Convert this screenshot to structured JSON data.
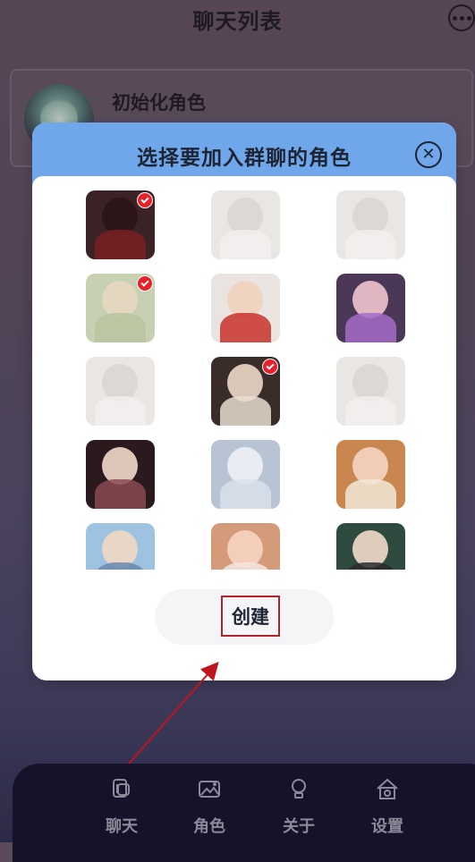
{
  "header": {
    "title": "聊天列表",
    "more_icon": "more-horizontal-icon"
  },
  "chat_list": [
    {
      "name": "初始化角色"
    }
  ],
  "modal": {
    "title": "选择要加入群聊的角色",
    "close_icon": "close-circle-icon",
    "roles": [
      {
        "selected": true,
        "face": "#2a1418",
        "body": "#7a1f22",
        "bg": "#3a2226"
      },
      {
        "selected": false,
        "face": "#dcd6d2",
        "body": "#f2efee",
        "bg": "#e9e6e4"
      },
      {
        "selected": false,
        "face": "#dcd6d2",
        "body": "#f2efee",
        "bg": "#e9e6e4"
      },
      {
        "selected": true,
        "face": "#e6d7c0",
        "body": "#b9c4a0",
        "bg": "#c8d0b4"
      },
      {
        "selected": false,
        "face": "#f0d2bc",
        "body": "#c9322a",
        "bg": "#e9e4e0"
      },
      {
        "selected": false,
        "face": "#f2c4cf",
        "body": "#a56bc7",
        "bg": "#4a3856"
      },
      {
        "selected": false,
        "face": "#dcd6d2",
        "body": "#f2efee",
        "bg": "#e9e6e4"
      },
      {
        "selected": true,
        "face": "#ecd8c8",
        "body": "#e8ddcf",
        "bg": "#3a2c28"
      },
      {
        "selected": false,
        "face": "#dcd6d2",
        "body": "#f2efee",
        "bg": "#e9e6e4"
      },
      {
        "selected": false,
        "face": "#f1d9c9",
        "body": "#8a4a52",
        "bg": "#2a1a1e"
      },
      {
        "selected": false,
        "face": "#eef2f6",
        "body": "#d8e0ea",
        "bg": "#b8c4d4"
      },
      {
        "selected": false,
        "face": "#f5d4c2",
        "body": "#f1e8d8",
        "bg": "#c9864e"
      },
      {
        "selected": false,
        "face": "#f0d8c4",
        "body": "#6a88b2",
        "bg": "#9ec3e0"
      },
      {
        "selected": false,
        "face": "#f5d4c2",
        "body": "#f2e6e0",
        "bg": "#d49a7a"
      },
      {
        "selected": false,
        "face": "#f2dccb",
        "body": "#2a2a30",
        "bg": "#2f4a3e"
      }
    ],
    "create_label": "创建"
  },
  "tabs": [
    {
      "label": "聊天",
      "icon": "chat-icon"
    },
    {
      "label": "角色",
      "icon": "image-icon"
    },
    {
      "label": "关于",
      "icon": "lightbulb-icon"
    },
    {
      "label": "设置",
      "icon": "home-settings-icon"
    }
  ],
  "colors": {
    "modal_header": "#6fa7ea",
    "check_badge": "#e8202a",
    "annotation": "#c0141c",
    "tab_bar": "#15132a"
  }
}
